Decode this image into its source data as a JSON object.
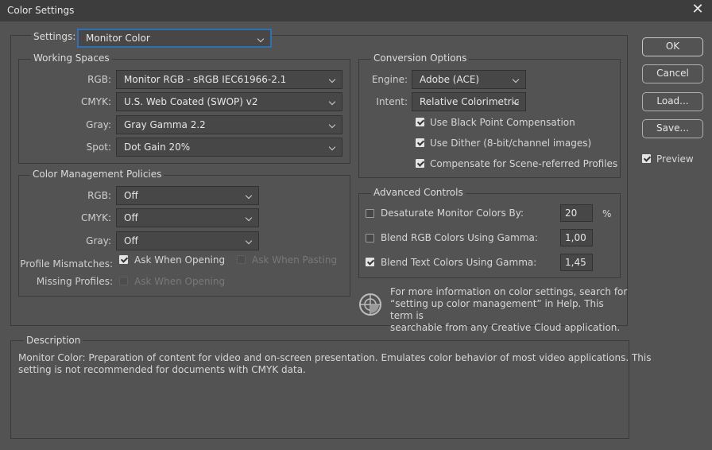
{
  "window": {
    "title": "Color Settings",
    "close_icon": "close-icon"
  },
  "settings": {
    "label": "Settings:",
    "value": "Monitor Color"
  },
  "working_spaces": {
    "title": "Working Spaces",
    "rgb": {
      "label": "RGB:",
      "value": "Monitor RGB - sRGB IEC61966-2.1"
    },
    "cmyk": {
      "label": "CMYK:",
      "value": "U.S. Web Coated (SWOP) v2"
    },
    "gray": {
      "label": "Gray:",
      "value": "Gray Gamma 2.2"
    },
    "spot": {
      "label": "Spot:",
      "value": "Dot Gain 20%"
    }
  },
  "policies": {
    "title": "Color Management Policies",
    "rgb": {
      "label": "RGB:",
      "value": "Off"
    },
    "cmyk": {
      "label": "CMYK:",
      "value": "Off"
    },
    "gray": {
      "label": "Gray:",
      "value": "Off"
    },
    "profile_mismatches": {
      "label": "Profile Mismatches:",
      "ask_opening": "Ask When Opening",
      "ask_opening_checked": true,
      "ask_pasting": "Ask When Pasting",
      "ask_pasting_checked": false
    },
    "missing_profiles": {
      "label": "Missing Profiles:",
      "ask_opening": "Ask When Opening",
      "ask_opening_checked": false
    }
  },
  "conversion": {
    "title": "Conversion Options",
    "engine": {
      "label": "Engine:",
      "value": "Adobe (ACE)"
    },
    "intent": {
      "label": "Intent:",
      "value": "Relative Colorimetric"
    },
    "black_point": {
      "label": "Use Black Point Compensation",
      "checked": true
    },
    "dither": {
      "label": "Use Dither (8-bit/channel images)",
      "checked": true
    },
    "scene_referred": {
      "label": "Compensate for Scene-referred Profiles",
      "checked": true
    }
  },
  "advanced": {
    "title": "Advanced Controls",
    "desaturate": {
      "label": "Desaturate Monitor Colors By:",
      "value": "20",
      "unit": "%",
      "checked": false
    },
    "blend_rgb": {
      "label": "Blend RGB Colors Using Gamma:",
      "value": "1,00",
      "checked": false
    },
    "blend_text": {
      "label": "Blend Text Colors Using Gamma:",
      "value": "1,45",
      "checked": true
    }
  },
  "info": {
    "line1": "For more information on color settings, search for",
    "line2": "“setting up color management” in Help. This term is",
    "line3": "searchable from any Creative Cloud application."
  },
  "description": {
    "title": "Description",
    "line1": "Monitor Color:  Preparation of content for video and on-screen presentation. Emulates color behavior of most video applications. This",
    "line2": "setting is not recommended for documents with CMYK data."
  },
  "buttons": {
    "ok": "OK",
    "cancel": "Cancel",
    "load": "Load...",
    "save": "Save..."
  },
  "preview": {
    "label": "Preview",
    "checked": true
  }
}
